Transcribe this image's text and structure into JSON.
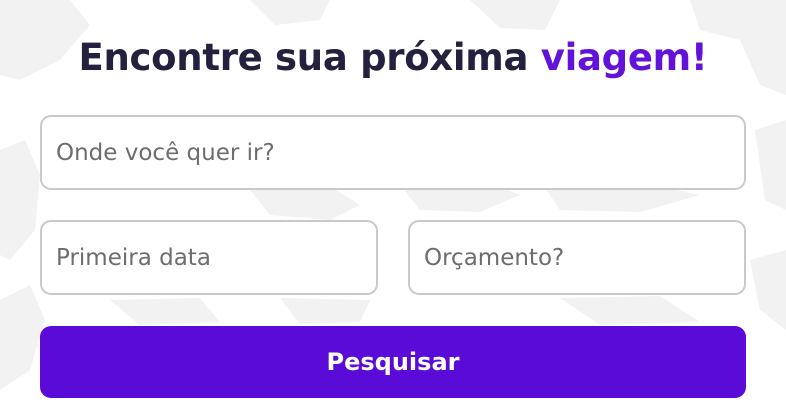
{
  "hero": {
    "title_main": "Encontre sua próxima ",
    "title_accent": "viagem!"
  },
  "form": {
    "destination_placeholder": "Onde você quer ir?",
    "date_placeholder": "Primeira data",
    "budget_placeholder": "Orçamento?",
    "submit_label": "Pesquisar"
  },
  "colors": {
    "accent": "#6212d9",
    "button": "#5b0bd8",
    "title": "#24213f",
    "field_border": "#c9c9c9"
  }
}
